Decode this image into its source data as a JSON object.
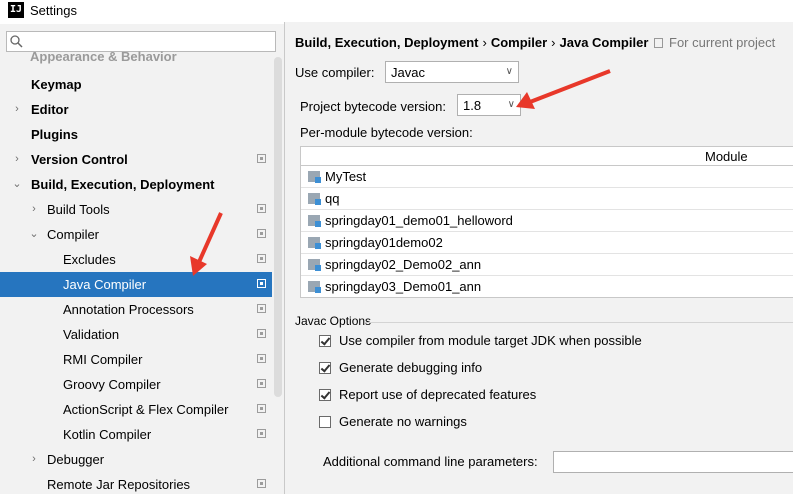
{
  "window": {
    "title": "Settings",
    "app_icon": "intellij-logo-icon"
  },
  "sidebar": {
    "search": {
      "value": "",
      "placeholder": ""
    },
    "items": [
      {
        "label": "Appearance & Behavior",
        "arrow": "",
        "bold": true,
        "cut": true
      },
      {
        "label": "Keymap",
        "arrow": "",
        "bold": true
      },
      {
        "label": "Editor",
        "arrow": "›",
        "bold": true
      },
      {
        "label": "Plugins",
        "arrow": "",
        "bold": true
      },
      {
        "label": "Version Control",
        "arrow": "›",
        "bold": true,
        "config": true
      },
      {
        "label": "Build, Execution, Deployment",
        "arrow": "⌄",
        "bold": true
      },
      {
        "label": "Build Tools",
        "arrow": "›",
        "config": true
      },
      {
        "label": "Compiler",
        "arrow": "⌄",
        "config": true
      },
      {
        "label": "Excludes",
        "config": true
      },
      {
        "label": "Java Compiler",
        "config": true,
        "selected": true
      },
      {
        "label": "Annotation Processors",
        "config": true
      },
      {
        "label": "Validation",
        "config": true
      },
      {
        "label": "RMI Compiler",
        "config": true
      },
      {
        "label": "Groovy Compiler",
        "config": true
      },
      {
        "label": "ActionScript & Flex Compiler",
        "config": true
      },
      {
        "label": "Kotlin Compiler",
        "config": true
      },
      {
        "label": "Debugger",
        "arrow": "›"
      },
      {
        "label": "Remote Jar Repositories",
        "config": true
      }
    ]
  },
  "breadcrumb": {
    "part1": "Build, Execution, Deployment",
    "sep1": "›",
    "part2": "Compiler",
    "sep2": "›",
    "part3": "Java Compiler"
  },
  "scope_note": "For current project",
  "use_compiler": {
    "label": "Use compiler:",
    "value": "Javac"
  },
  "bytecode": {
    "label": "Project bytecode version:",
    "value": "1.8"
  },
  "per_module": {
    "label": "Per-module bytecode version:",
    "column_header": "Module",
    "modules": [
      "MyTest",
      "qq",
      "springday01_demo01_helloword",
      "springday01demo02",
      "springday02_Demo02_ann",
      "springday03_Demo01_ann"
    ]
  },
  "javac_options": {
    "legend": "Javac Options",
    "checkboxes": [
      {
        "label": "Use compiler from module target JDK when possible",
        "checked": true
      },
      {
        "label": "Generate debugging info",
        "checked": true
      },
      {
        "label": "Report use of deprecated features",
        "checked": true
      },
      {
        "label": "Generate no warnings",
        "checked": false
      }
    ],
    "params_label": "Additional command line parameters:",
    "params_value": ""
  },
  "colors": {
    "selection": "#2675bf",
    "annotation_arrow": "#e8382a",
    "panel_bg": "#f2f2f2"
  }
}
